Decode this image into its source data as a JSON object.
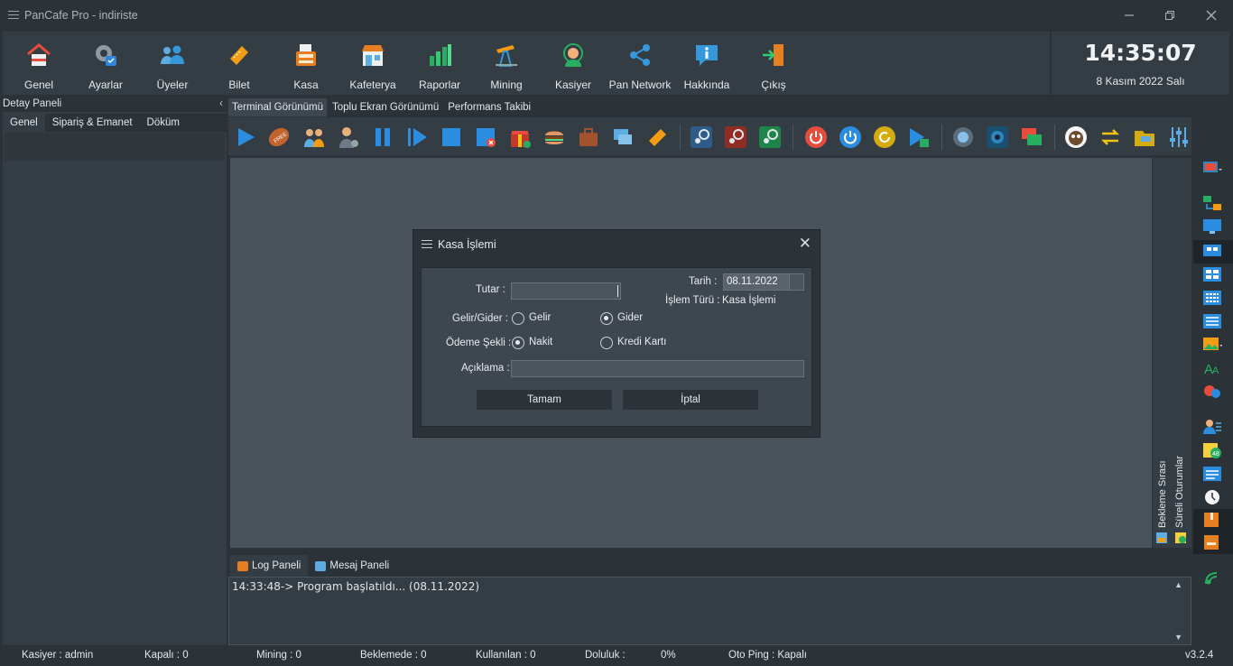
{
  "window": {
    "title": "PanCafe Pro - indiriste"
  },
  "toolbar": {
    "items": [
      {
        "label": "Genel",
        "icon": "home-icon"
      },
      {
        "label": "Ayarlar",
        "icon": "settings-gear-icon"
      },
      {
        "label": "Üyeler",
        "icon": "members-icon"
      },
      {
        "label": "Bilet",
        "icon": "ticket-icon"
      },
      {
        "label": "Kasa",
        "icon": "cash-register-icon"
      },
      {
        "label": "Kafeterya",
        "icon": "cafeteria-shop-icon"
      },
      {
        "label": "Raporlar",
        "icon": "report-chart-icon"
      },
      {
        "label": "Mining",
        "icon": "mining-pump-icon"
      },
      {
        "label": "Kasiyer",
        "icon": "cashier-headset-icon"
      },
      {
        "label": "Pan Network",
        "icon": "share-network-icon"
      },
      {
        "label": "Hakkında",
        "icon": "info-icon"
      },
      {
        "label": "Çıkış",
        "icon": "exit-door-icon"
      }
    ]
  },
  "clock": {
    "time": "14:35:07",
    "date": "8 Kasım 2022 Salı"
  },
  "left_panel": {
    "title": "Detay Paneli",
    "tabs": [
      "Genel",
      "Sipariş & Emanet",
      "Döküm"
    ]
  },
  "view_tabs": [
    "Terminal Görünümü",
    "Toplu Ekran Görünümü",
    "Performans Takibi"
  ],
  "queue_panel": {
    "waiting_label": "Bekleme Sırası",
    "timed_label": "Süreli Oturumlar"
  },
  "dialog": {
    "title": "Kasa İşlemi",
    "amount_label": "Tutar :",
    "amount_value": "",
    "date_label": "Tarih :",
    "date_value": "08.11.2022",
    "type_label": "İşlem Türü :",
    "type_value": "Kasa İşlemi",
    "income_expense_label": "Gelir/Gider :",
    "income_option": "Gelir",
    "expense_option": "Gider",
    "income_expense_selected": "Gider",
    "payment_label": "Ödeme Şekli :",
    "cash_option": "Nakit",
    "card_option": "Kredi Kartı",
    "payment_selected": "Nakit",
    "note_label": "Açıklama :",
    "note_value": "",
    "ok_label": "Tamam",
    "cancel_label": "İptal"
  },
  "bottom_tabs": {
    "log": "Log Paneli",
    "message": "Mesaj Paneli"
  },
  "log": {
    "lines": [
      "14:33:48-> Program başlatıldı... (08.11.2022)"
    ]
  },
  "status": {
    "cashier": "Kasiyer : admin",
    "closed": "Kapalı : 0",
    "mining": "Mining : 0",
    "waiting": "Beklemede : 0",
    "used": "Kullanılan : 0",
    "occupancy_label": "Doluluk :",
    "occupancy_value": "0%",
    "auto_ping": "Oto Ping : Kapalı",
    "version": "v3.2.4"
  },
  "colors": {
    "background": "#2b3238",
    "panel": "#353d44",
    "workspace": "#4a535c",
    "accent_blue": "#2b8de0"
  }
}
